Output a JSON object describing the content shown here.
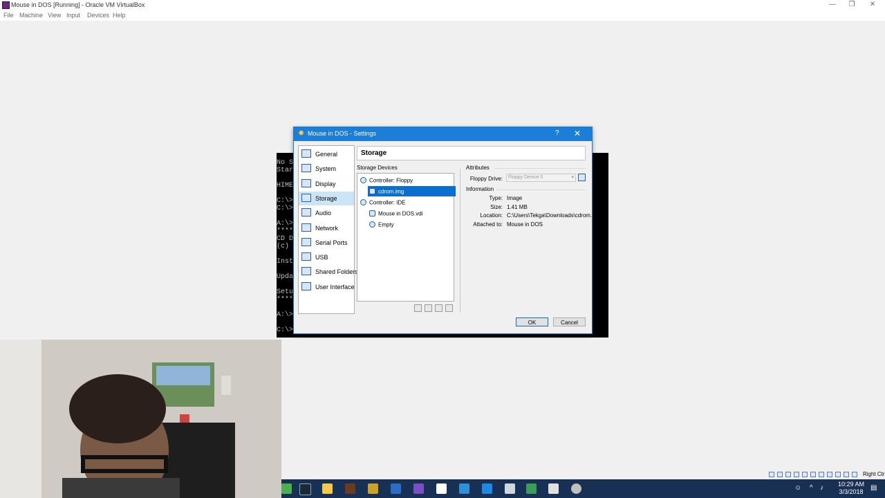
{
  "window": {
    "title": "Mouse in DOS [Running] - Oracle VM VirtualBox",
    "minimize": "—",
    "restore": "❐",
    "close": "✕"
  },
  "menu": [
    "File",
    "Machine",
    "View",
    "Input",
    "Devices",
    "Help"
  ],
  "vm_screen": {
    "lines": [
      "No S",
      "Star",
      "",
      "HIME",
      "",
      "C:\\>",
      "C:\\>",
      "",
      "A:\\>",
      "****",
      "CD D",
      "(c)",
      "",
      "Inst",
      "",
      "Upda",
      "",
      "Setu",
      "****",
      "",
      "A:\\>",
      "",
      "C:\\>"
    ]
  },
  "dialog": {
    "title": "Mouse in DOS - Settings",
    "help": "?",
    "close": "✕",
    "nav": [
      {
        "label": "General",
        "icon": "general-icon"
      },
      {
        "label": "System",
        "icon": "system-icon"
      },
      {
        "label": "Display",
        "icon": "display-icon"
      },
      {
        "label": "Storage",
        "icon": "storage-icon",
        "selected": true
      },
      {
        "label": "Audio",
        "icon": "audio-icon"
      },
      {
        "label": "Network",
        "icon": "network-icon"
      },
      {
        "label": "Serial Ports",
        "icon": "serial-ports-icon"
      },
      {
        "label": "USB",
        "icon": "usb-icon"
      },
      {
        "label": "Shared Folders",
        "icon": "shared-folders-icon"
      },
      {
        "label": "User Interface",
        "icon": "user-interface-icon"
      }
    ],
    "page_title": "Storage",
    "storage_devices_label": "Storage Devices",
    "tree": [
      {
        "label": "Controller: Floppy",
        "level": 0,
        "icon": "floppy-controller-icon"
      },
      {
        "label": "cdrom.img",
        "level": 1,
        "icon": "floppy-disk-icon",
        "selected": true
      },
      {
        "label": "Controller: IDE",
        "level": 0,
        "icon": "ide-controller-icon"
      },
      {
        "label": "Mouse in DOS.vdi",
        "level": 1,
        "icon": "hard-disk-icon"
      },
      {
        "label": "Empty",
        "level": 1,
        "icon": "optical-disc-icon"
      }
    ],
    "attributes_label": "Attributes",
    "floppy_drive_label": "Floppy Drive:",
    "floppy_drive_value": "Floppy Device 0",
    "information_label": "Information",
    "info": {
      "type_label": "Type:",
      "type_value": "Image",
      "size_label": "Size:",
      "size_value": "1.41 MB",
      "location_label": "Location:",
      "location_value": "C:\\Users\\Tekga\\Downloads\\cdrom...",
      "attached_label": "Attached to:",
      "attached_value": "Mouse in DOS"
    },
    "ok_label": "OK",
    "cancel_label": "Cancel"
  },
  "statusbar": {
    "host_key": "Right Ctrl"
  },
  "taskbar": {
    "time": "10:29 AM",
    "date": "3/3/2018"
  },
  "colors": {
    "accent": "#1c7ed6",
    "selection": "#0a6ed1",
    "taskbar": "#173054"
  }
}
